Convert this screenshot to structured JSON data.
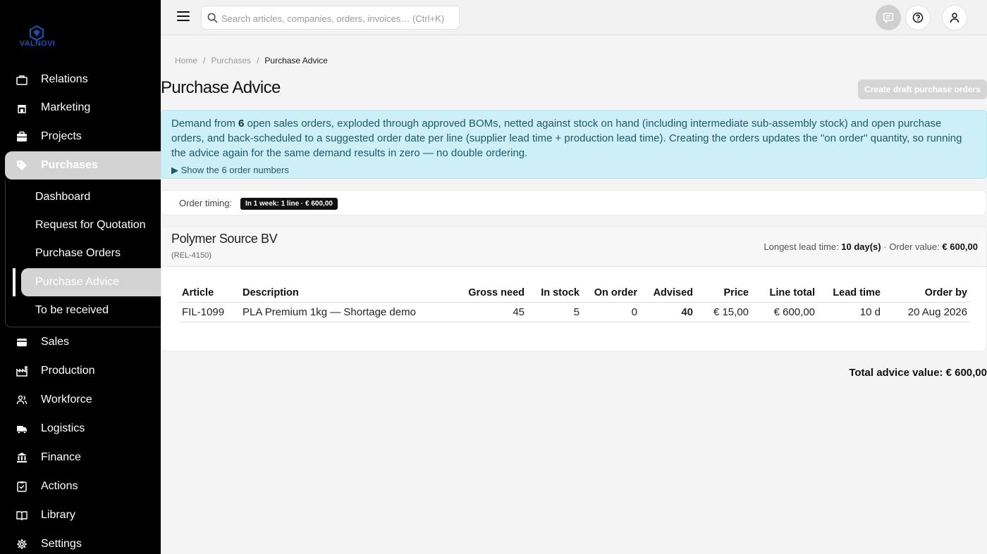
{
  "brand": {
    "name": "VALNOVI",
    "color": "#1f4fa8"
  },
  "sidebar": {
    "items": [
      {
        "label": "Relations",
        "icon": "relations-icon"
      },
      {
        "label": "Marketing",
        "icon": "marketing-icon"
      },
      {
        "label": "Projects",
        "icon": "projects-icon"
      },
      {
        "label": "Purchases",
        "icon": "tag-icon"
      },
      {
        "label": "Sales",
        "icon": "sales-icon"
      },
      {
        "label": "Production",
        "icon": "production-icon"
      },
      {
        "label": "Workforce",
        "icon": "workforce-icon"
      },
      {
        "label": "Logistics",
        "icon": "truck-icon"
      },
      {
        "label": "Finance",
        "icon": "bank-icon"
      },
      {
        "label": "Actions",
        "icon": "clipboard-check-icon"
      },
      {
        "label": "Library",
        "icon": "book-icon"
      },
      {
        "label": "Settings",
        "icon": "gear-icon"
      }
    ],
    "submenu": [
      {
        "label": "Dashboard"
      },
      {
        "label": "Request for Quotation"
      },
      {
        "label": "Purchase Orders"
      },
      {
        "label": "Purchase Advice"
      },
      {
        "label": "To be received"
      }
    ]
  },
  "topbar": {
    "search_placeholder": "Search articles, companies, orders, invoices… (Ctrl+K)"
  },
  "breadcrumb": {
    "home": "Home",
    "section": "Purchases",
    "current": "Purchase Advice",
    "separator": "/"
  },
  "page": {
    "title": "Purchase Advice",
    "create_button": "Create draft purchase orders"
  },
  "info": {
    "prefix": "Demand from ",
    "count": "6",
    "text": " open sales orders, exploded through approved BOMs, netted against stock on hand (including intermediate sub-assembly stock) and open purchase orders, and back-scheduled to a suggested order date per line (supplier lead time + production lead time). Creating the orders updates the \"on order\" quantity, so running the advice again for the same demand results in zero — no double ordering.",
    "toggle": "Show the 6 order numbers"
  },
  "timing": {
    "label": "Order timing:",
    "chip": "In 1 week: 1 line · € 600,00"
  },
  "supplier": {
    "name": "Polymer Source BV",
    "code": "(REL-4150)",
    "lead_label": "Longest lead time:",
    "lead_value": "10 day(s)",
    "separator": "·",
    "order_label": "Order value:",
    "order_value": "€ 600,00"
  },
  "table": {
    "columns": [
      "Article",
      "Description",
      "Gross need",
      "In stock",
      "On order",
      "Advised",
      "Price",
      "Line total",
      "Lead time",
      "Order by"
    ],
    "rows": [
      [
        "FIL-1099",
        "PLA Premium 1kg — Shortage demo",
        "45",
        "5",
        "0",
        "40",
        "€ 15,00",
        "€ 600,00",
        "10 d",
        "20 Aug 2026"
      ]
    ]
  },
  "total": "Total advice value: € 600,00"
}
